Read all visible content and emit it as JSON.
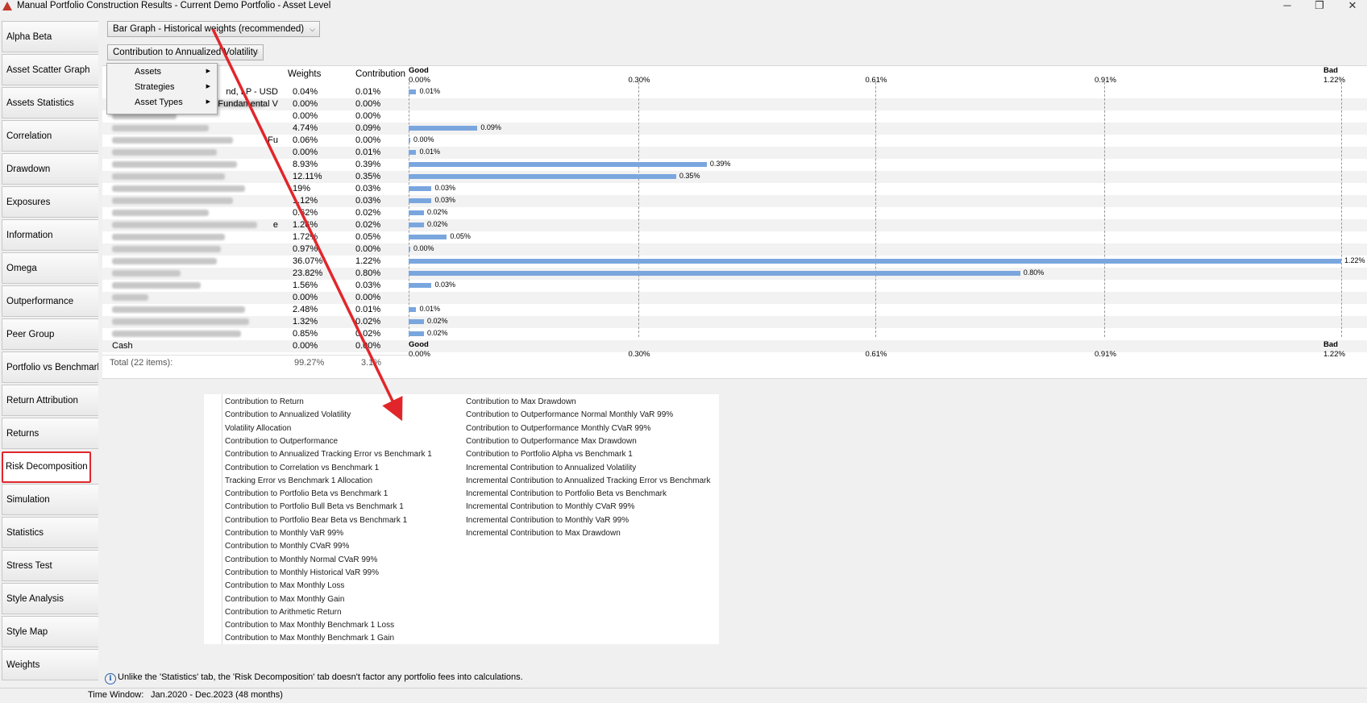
{
  "window": {
    "title": "Manual Portfolio Construction Results - Current Demo Portfolio - Asset Level",
    "controls": [
      "─",
      "❐",
      "✕"
    ]
  },
  "sidebar": {
    "items": [
      {
        "label": "Alpha Beta"
      },
      {
        "label": "Asset Scatter Graph"
      },
      {
        "label": "Assets Statistics"
      },
      {
        "label": "Correlation"
      },
      {
        "label": "Drawdown"
      },
      {
        "label": "Exposures"
      },
      {
        "label": "Information"
      },
      {
        "label": "Omega"
      },
      {
        "label": "Outperformance"
      },
      {
        "label": "Peer Group"
      },
      {
        "label": "Portfolio vs Benchmark"
      },
      {
        "label": "Return Attribution"
      },
      {
        "label": "Returns"
      },
      {
        "label": "Risk Decomposition"
      },
      {
        "label": "Simulation"
      },
      {
        "label": "Statistics"
      },
      {
        "label": "Stress Test"
      },
      {
        "label": "Style Analysis"
      },
      {
        "label": "Style Map"
      },
      {
        "label": "Weights"
      }
    ],
    "active": "Risk Decomposition",
    "active_border_color": "#e1262b"
  },
  "controls": {
    "graph_type": "Bar Graph - Historical weights (recommended)",
    "metric": "Contribution to Annualized Volatility"
  },
  "context_menu": {
    "items": [
      "Assets",
      "Strategies",
      "Asset Types"
    ]
  },
  "table": {
    "headers": {
      "weights": "Weights",
      "contribution": "Contribution"
    },
    "rows": [
      {
        "name": "nd, LP - USD",
        "weight": "0.04%",
        "contribution": "0.01%"
      },
      {
        "name": "Fundamental V",
        "weight": "0.00%",
        "contribution": "0.00%"
      },
      {
        "name": "",
        "weight": "0.00%",
        "contribution": "0.00%"
      },
      {
        "name": "",
        "weight": "4.74%",
        "contribution": "0.09%"
      },
      {
        "name": "Fu",
        "weight": "0.06%",
        "contribution": "0.00%"
      },
      {
        "name": "",
        "weight": "0.00%",
        "contribution": "0.01%"
      },
      {
        "name": "",
        "weight": "8.93%",
        "contribution": "0.39%"
      },
      {
        "name": "",
        "weight": "12.11%",
        "contribution": "0.35%"
      },
      {
        "name": "",
        "weight": "19%",
        "contribution": "0.03%"
      },
      {
        "name": "",
        "weight": "1.12%",
        "contribution": "0.03%"
      },
      {
        "name": "",
        "weight": "0.62%",
        "contribution": "0.02%"
      },
      {
        "name": "e",
        "weight": "1.26%",
        "contribution": "0.02%"
      },
      {
        "name": "",
        "weight": "1.72%",
        "contribution": "0.05%"
      },
      {
        "name": "",
        "weight": "0.97%",
        "contribution": "0.00%"
      },
      {
        "name": "",
        "weight": "36.07%",
        "contribution": "1.22%"
      },
      {
        "name": "",
        "weight": "23.82%",
        "contribution": "0.80%"
      },
      {
        "name": "",
        "weight": "1.56%",
        "contribution": "0.03%"
      },
      {
        "name": "",
        "weight": "0.00%",
        "contribution": "0.00%"
      },
      {
        "name": "",
        "weight": "2.48%",
        "contribution": "0.01%"
      },
      {
        "name": "",
        "weight": "1.32%",
        "contribution": "0.02%"
      },
      {
        "name": "",
        "weight": "0.85%",
        "contribution": "0.02%"
      },
      {
        "name": "Cash",
        "weight": "0.00%",
        "contribution": "0.00%"
      }
    ],
    "total": {
      "label": "Total (22 items):",
      "weight": "99.27%",
      "contribution": "3.1%"
    }
  },
  "chart_data": {
    "type": "bar",
    "orientation": "horizontal",
    "axis_left_label": "Good",
    "axis_right_label": "Bad",
    "ticks": [
      "0.00%",
      "0.30%",
      "0.61%",
      "0.91%",
      "1.22%"
    ],
    "xlim": [
      0,
      1.22
    ],
    "grid": true,
    "bar_color": "#7aa6de",
    "values": [
      0.01,
      0.0,
      0.0,
      0.09,
      0.0,
      0.01,
      0.39,
      0.35,
      0.03,
      0.03,
      0.02,
      0.02,
      0.05,
      0.0,
      1.22,
      0.8,
      0.03,
      0.0,
      0.01,
      0.02,
      0.02,
      0.0
    ],
    "labels": [
      "0.01%",
      "",
      "",
      "0.09%",
      "0.00%",
      "0.01%",
      "0.39%",
      "0.35%",
      "0.03%",
      "0.03%",
      "0.02%",
      "0.02%",
      "0.05%",
      "0.00%",
      "1.22%",
      "0.80%",
      "0.03%",
      "",
      "0.01%",
      "0.02%",
      "0.02%",
      ""
    ]
  },
  "metric_list": {
    "left": [
      "Contribution to Return",
      "Contribution to Annualized Volatility",
      "Volatility Allocation",
      "Contribution to Outperformance",
      "Contribution to Annualized Tracking Error vs Benchmark 1",
      "Contribution to Correlation vs Benchmark 1",
      "Tracking Error vs Benchmark 1 Allocation",
      "Contribution to Portfolio Beta vs Benchmark 1",
      "Contribution to Portfolio Bull Beta vs Benchmark 1",
      "Contribution to Portfolio Bear Beta vs Benchmark 1",
      "Contribution to Monthly VaR 99%",
      "Contribution to Monthly CVaR 99%",
      "Contribution to Monthly Normal CVaR 99%",
      "Contribution to Monthly Historical VaR 99%",
      "Contribution to Max Monthly Loss",
      "Contribution to Max Monthly Gain",
      "Contribution to Arithmetic Return",
      "Contribution to Max Monthly Benchmark 1 Loss",
      "Contribution to Max Monthly Benchmark 1 Gain"
    ],
    "right": [
      "Contribution to Max Drawdown",
      "Contribution to Outperformance Normal Monthly VaR 99%",
      "Contribution to Outperformance Monthly CVaR 99%",
      "Contribution to Outperformance Max Drawdown",
      "Contribution to Portfolio Alpha vs Benchmark 1",
      "Incremental Contribution to Annualized Volatility",
      "Incremental Contribution to Annualized Tracking Error vs Benchmark",
      "Incremental Contribution to Portfolio Beta vs Benchmark",
      "Incremental Contribution to Monthly CVaR 99%",
      "Incremental Contribution to Monthly VaR 99%",
      "Incremental Contribution to Max Drawdown"
    ]
  },
  "info_text": "Unlike the 'Statistics' tab, the 'Risk Decomposition' tab doesn't factor any portfolio fees into calculations.",
  "status": {
    "label": "Time Window:",
    "value": "Jan.2020 - Dec.2023 (48 months)"
  },
  "annotation_color": "#e1262b"
}
